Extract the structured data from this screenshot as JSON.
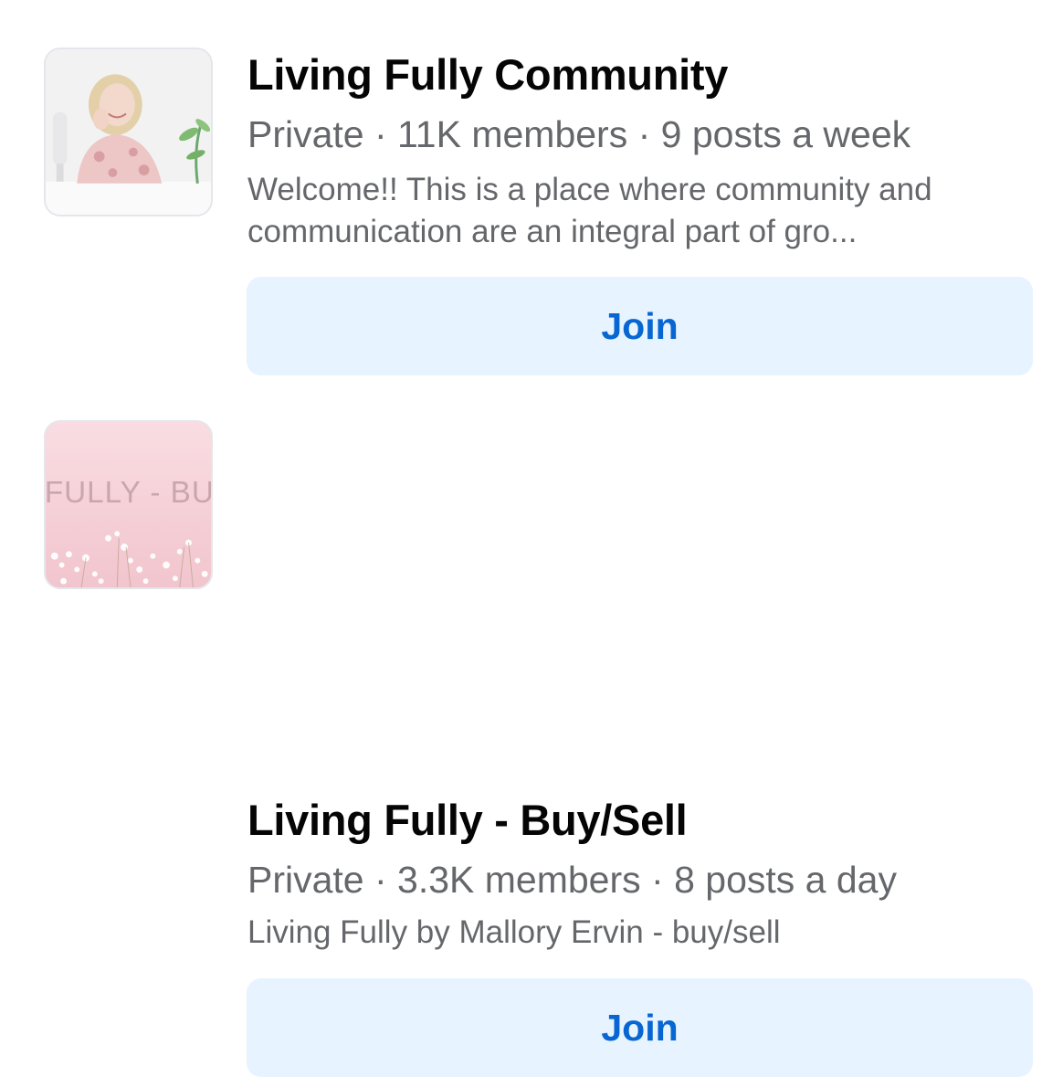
{
  "groups": [
    {
      "title": "Living Fully Community",
      "meta": "Private · 11K members · 9 posts a week",
      "description": "Welcome!! This is a place where community and communication are an integral part of gro...",
      "join_label": "Join"
    },
    {
      "title": "Living Fully - Buy/Sell",
      "meta": "Private · 3.3K members · 8 posts a day",
      "description": "Living Fully by Mallory Ervin - buy/sell",
      "join_label": "Join",
      "thumbnail_text": "G FULLY - BUY/"
    }
  ],
  "colors": {
    "title": "#050505",
    "secondary_text": "#65676b",
    "join_bg": "#e7f3ff",
    "join_text": "#0866d2"
  }
}
